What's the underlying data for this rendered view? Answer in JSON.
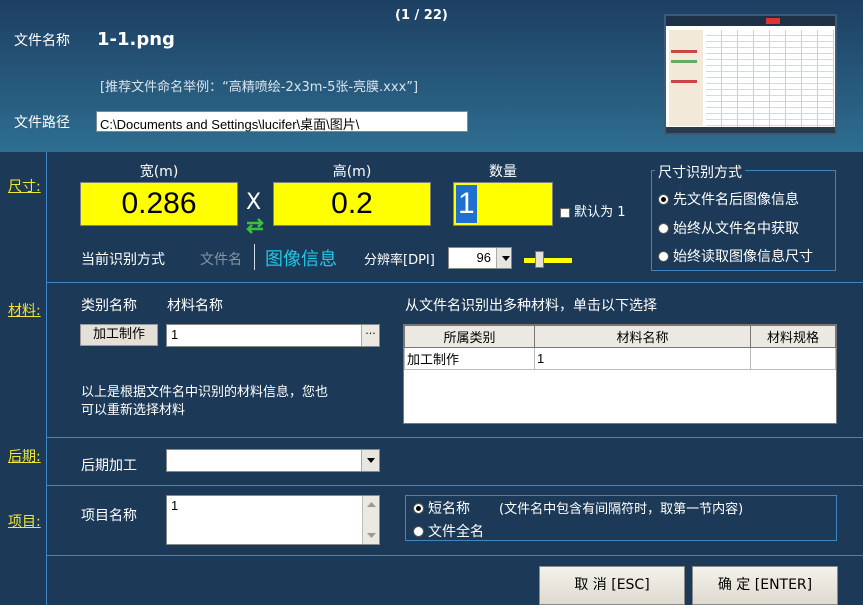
{
  "header": {
    "counter": "(1 / 22)",
    "file_name_label": "文件名称",
    "file_name": "1-1.png",
    "hint": "[推荐文件命名举例：“高精喷绘-2x3m-5张-亮膜.xxx”]",
    "file_path_label": "文件路径",
    "file_path": "C:\\Documents and Settings\\lucifer\\桌面\\图片\\"
  },
  "sections": {
    "size": "尺寸:",
    "material": "材料:",
    "post": "后期:",
    "project": "项目:"
  },
  "size": {
    "width_label": "宽(m)",
    "width_value": "0.286",
    "times": "X",
    "height_label": "高(m)",
    "height_value": "0.2",
    "qty_label": "数量",
    "qty_value": "1",
    "default_label": "默认为 1",
    "current_mode_label": "当前识别方式",
    "mode_filename": "文件名",
    "mode_image": "图像信息",
    "dpi_label": "分辨率[DPI]",
    "dpi_value": "96",
    "group_title": "尺寸识别方式",
    "options": [
      "先文件名后图像信息",
      "始终从文件名中获取",
      "始终读取图像信息尺寸"
    ],
    "selected": 0
  },
  "material": {
    "category_label": "类别名称",
    "material_label": "材料名称",
    "category_value": "加工制作",
    "material_value": "1",
    "ellipsis": "···",
    "multi_hint": "从文件名识别出多种材料，单击以下选择",
    "columns": [
      "所属类别",
      "材料名称",
      "材料规格"
    ],
    "rows": [
      [
        "加工制作",
        "1",
        ""
      ]
    ],
    "note_line1": "以上是根据文件名中识别的材料信息，您也",
    "note_line2": "可以重新选择材料"
  },
  "post": {
    "label": "后期加工",
    "value": ""
  },
  "project": {
    "label": "项目名称",
    "value": "1",
    "options": [
      "短名称",
      "文件全名"
    ],
    "short_note": "(文件名中包含有间隔符时，取第一节内容)",
    "selected": 0
  },
  "buttons": {
    "cancel": "取 消 [ESC]",
    "ok": "确 定 [ENTER]"
  },
  "colors": {
    "accent_yellow": "#ffff00",
    "section_label": "#f0e63a",
    "image_mode": "#1ec8e6",
    "divider": "#3e86c4",
    "background": "#1c3a57"
  },
  "icons": {
    "swap": "swap-arrows-icon",
    "dropdown": "chevron-down-icon",
    "slider": "slider-thumb-icon"
  }
}
